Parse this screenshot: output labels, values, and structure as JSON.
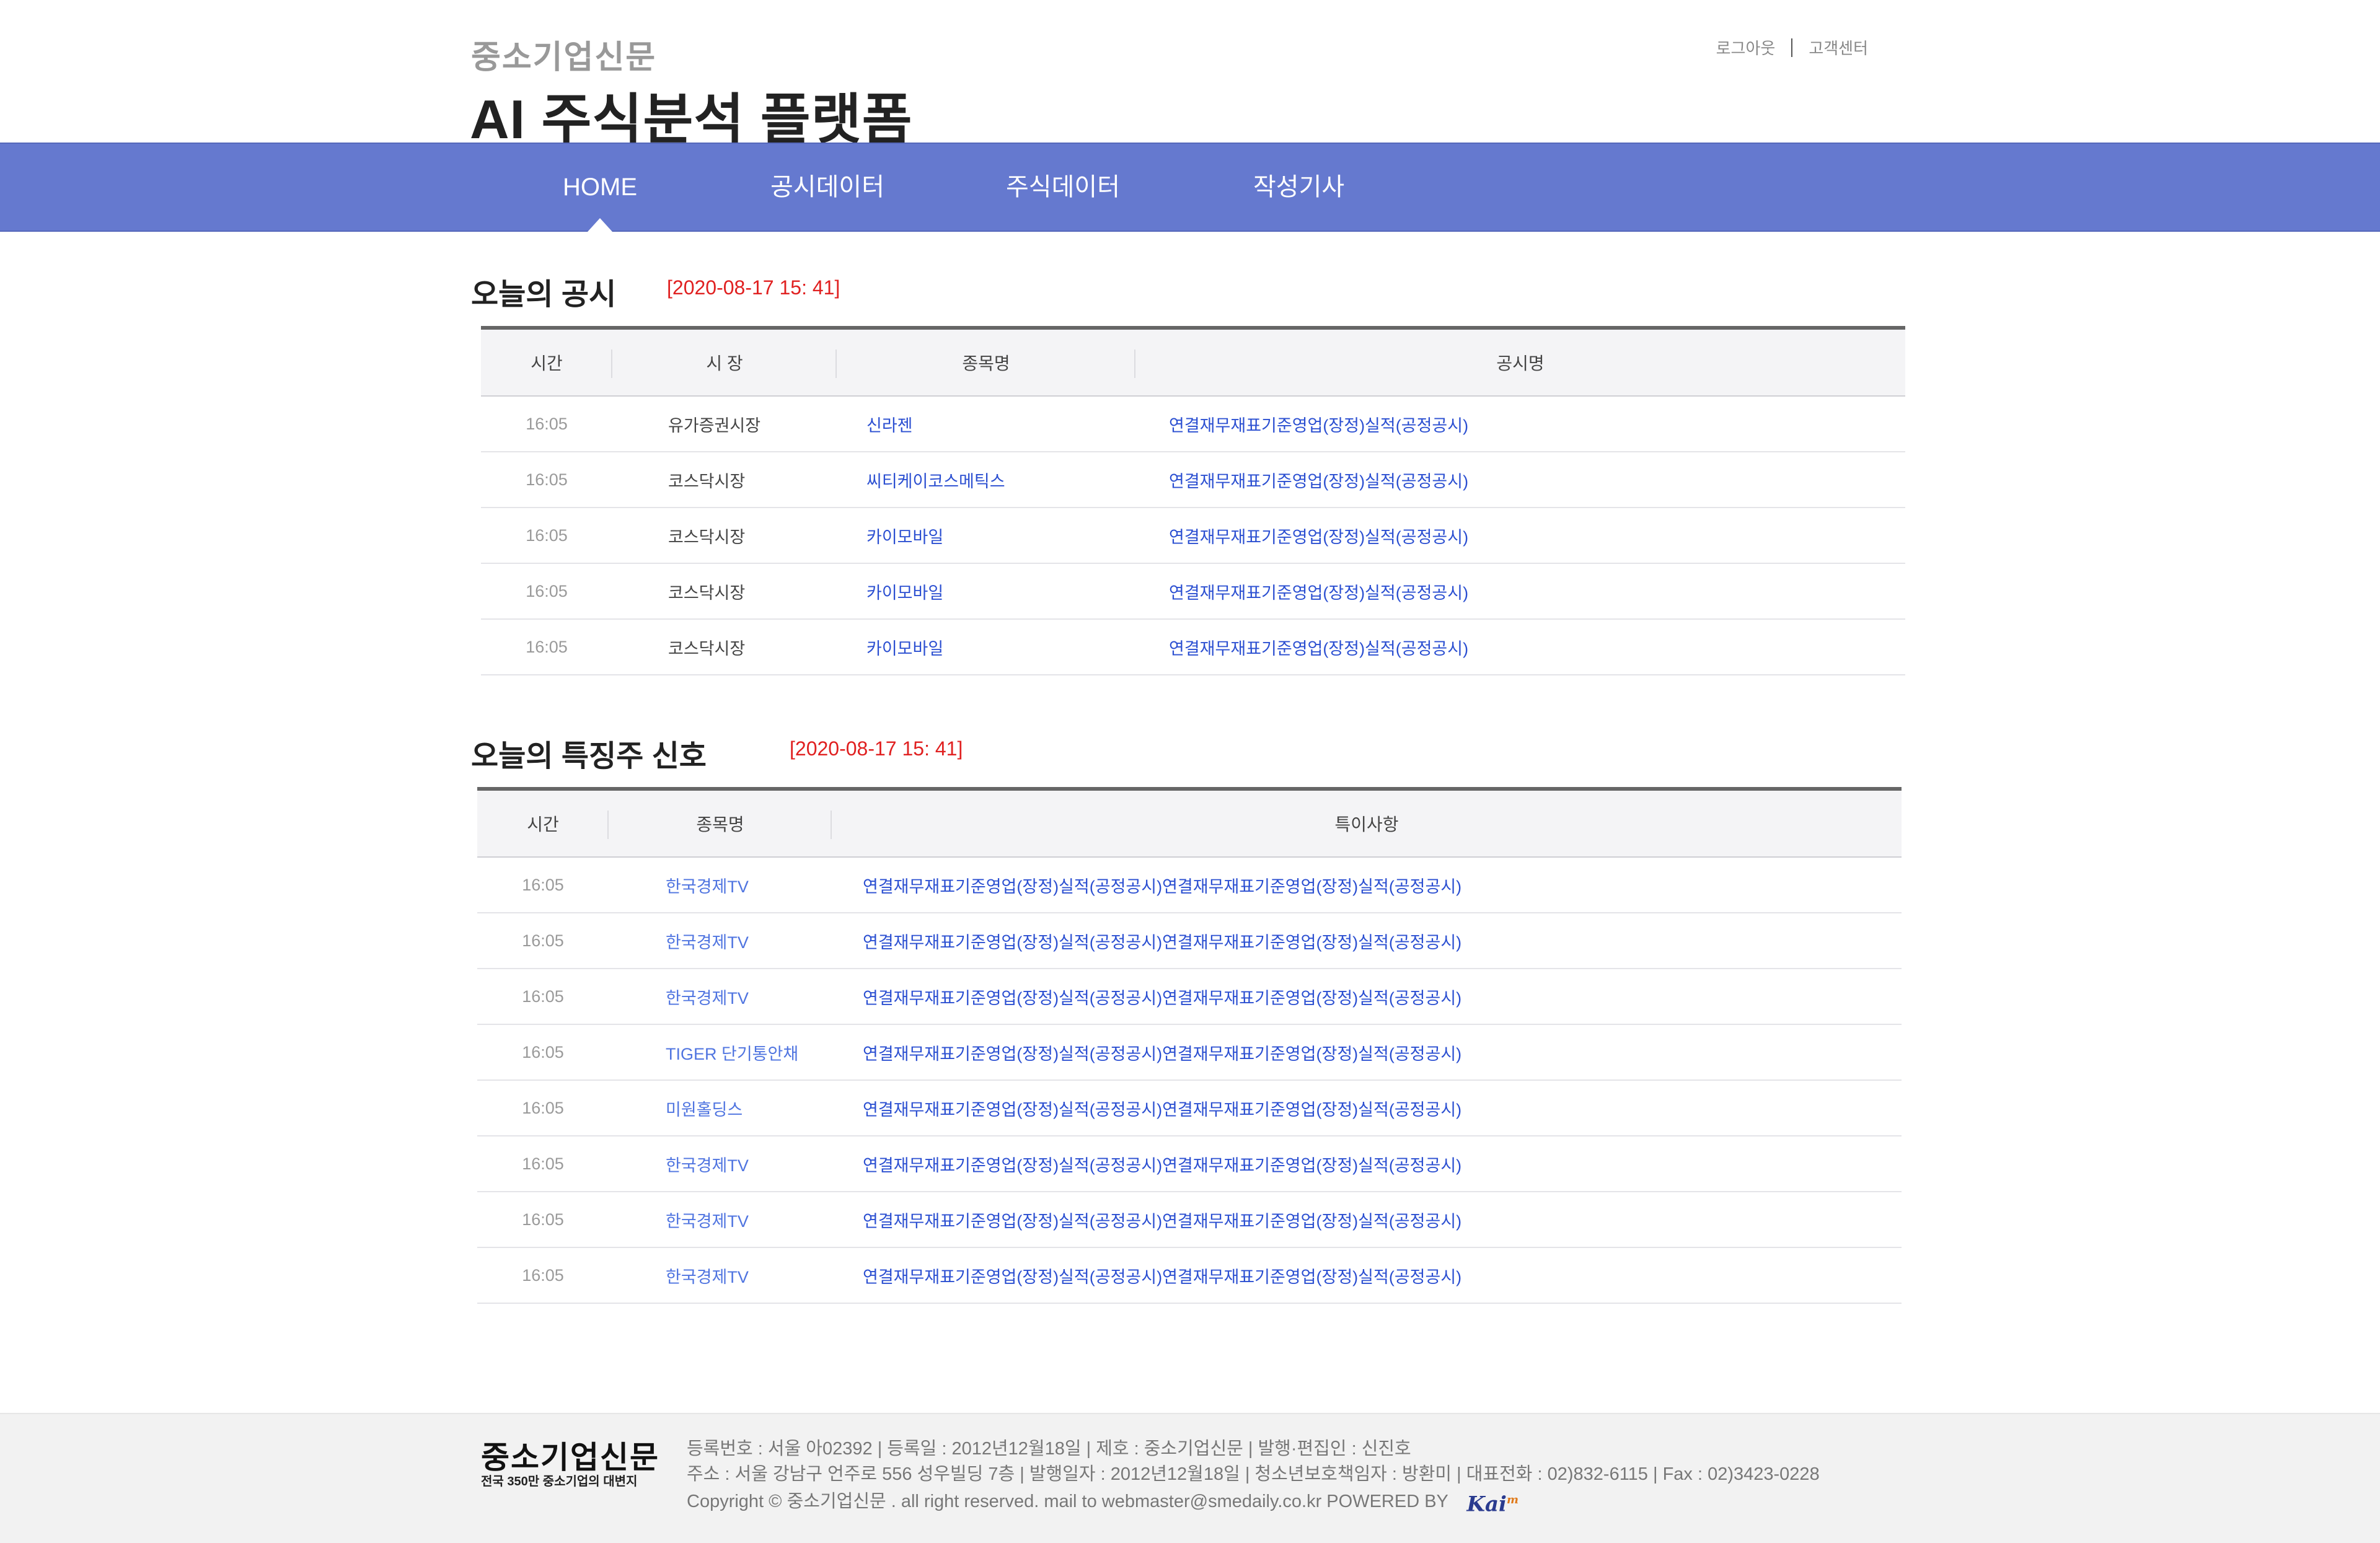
{
  "header": {
    "brand_small": "중소기업신문",
    "title": "AI 주식분석 플랫폼",
    "logout": "로그아웃",
    "support": "고객센터"
  },
  "nav": {
    "items": [
      {
        "label": "HOME",
        "active": true
      },
      {
        "label": "공시데이터",
        "active": false
      },
      {
        "label": "주식데이터",
        "active": false
      },
      {
        "label": "작성기사",
        "active": false
      }
    ]
  },
  "disclosures": {
    "title": "오늘의 공시",
    "timestamp": "[2020-08-17 15: 41]",
    "columns": [
      "시간",
      "시 장",
      "종목명",
      "공시명"
    ],
    "rows": [
      {
        "time": "16:05",
        "market": "유가증권시장",
        "name": "신라젠",
        "disclosure": "연결재무재표기준영업(장정)실적(공정공시)"
      },
      {
        "time": "16:05",
        "market": "코스닥시장",
        "name": "씨티케이코스메틱스",
        "disclosure": "연결재무재표기준영업(장정)실적(공정공시)"
      },
      {
        "time": "16:05",
        "market": "코스닥시장",
        "name": "카이모바일",
        "disclosure": "연결재무재표기준영업(장정)실적(공정공시)"
      },
      {
        "time": "16:05",
        "market": "코스닥시장",
        "name": "카이모바일",
        "disclosure": "연결재무재표기준영업(장정)실적(공정공시)"
      },
      {
        "time": "16:05",
        "market": "코스닥시장",
        "name": "카이모바일",
        "disclosure": "연결재무재표기준영업(장정)실적(공정공시)"
      }
    ]
  },
  "signals": {
    "title": "오늘의 특징주 신호",
    "timestamp": "[2020-08-17 15: 41]",
    "columns": [
      "시간",
      "종목명",
      "특이사항"
    ],
    "rows": [
      {
        "time": "16:05",
        "name": "한국경제TV",
        "note": "연결재무재표기준영업(장정)실적(공정공시)연결재무재표기준영업(장정)실적(공정공시)"
      },
      {
        "time": "16:05",
        "name": "한국경제TV",
        "note": "연결재무재표기준영업(장정)실적(공정공시)연결재무재표기준영업(장정)실적(공정공시)"
      },
      {
        "time": "16:05",
        "name": "한국경제TV",
        "note": "연결재무재표기준영업(장정)실적(공정공시)연결재무재표기준영업(장정)실적(공정공시)"
      },
      {
        "time": "16:05",
        "name": "TIGER 단기통안채",
        "note": "연결재무재표기준영업(장정)실적(공정공시)연결재무재표기준영업(장정)실적(공정공시)"
      },
      {
        "time": "16:05",
        "name": "미원홀딩스",
        "note": "연결재무재표기준영업(장정)실적(공정공시)연결재무재표기준영업(장정)실적(공정공시)"
      },
      {
        "time": "16:05",
        "name": "한국경제TV",
        "note": "연결재무재표기준영업(장정)실적(공정공시)연결재무재표기준영업(장정)실적(공정공시)"
      },
      {
        "time": "16:05",
        "name": "한국경제TV",
        "note": "연결재무재표기준영업(장정)실적(공정공시)연결재무재표기준영업(장정)실적(공정공시)"
      },
      {
        "time": "16:05",
        "name": "한국경제TV",
        "note": "연결재무재표기준영업(장정)실적(공정공시)연결재무재표기준영업(장정)실적(공정공시)"
      }
    ]
  },
  "footer": {
    "logo": "중소기업신문",
    "tagline": "전국 350만 중소기업의 대변지",
    "line1": "등록번호 : 서울 아02392 | 등록일 : 2012년12월18일 | 제호 : 중소기업신문 | 발행·편집인 : 신진호",
    "line2": "주소 : 서울 강남구 언주로 556 성우빌딩 7층 | 발행일자 : 2012년12월18일 | 청소년보호책임자 : 방환미 | 대표전화 : 02)832-6115 | Fax : 02)3423-0228",
    "line3": "Copyright © 중소기업신문 . all right reserved. mail to webmaster@smedaily.co.kr  POWERED BY",
    "powered_logo": "Kai",
    "powered_logo_mark": "m"
  },
  "colors": {
    "nav_bg": "#6579cf",
    "timestamp": "#e02020",
    "link": "#2b4fd1"
  }
}
